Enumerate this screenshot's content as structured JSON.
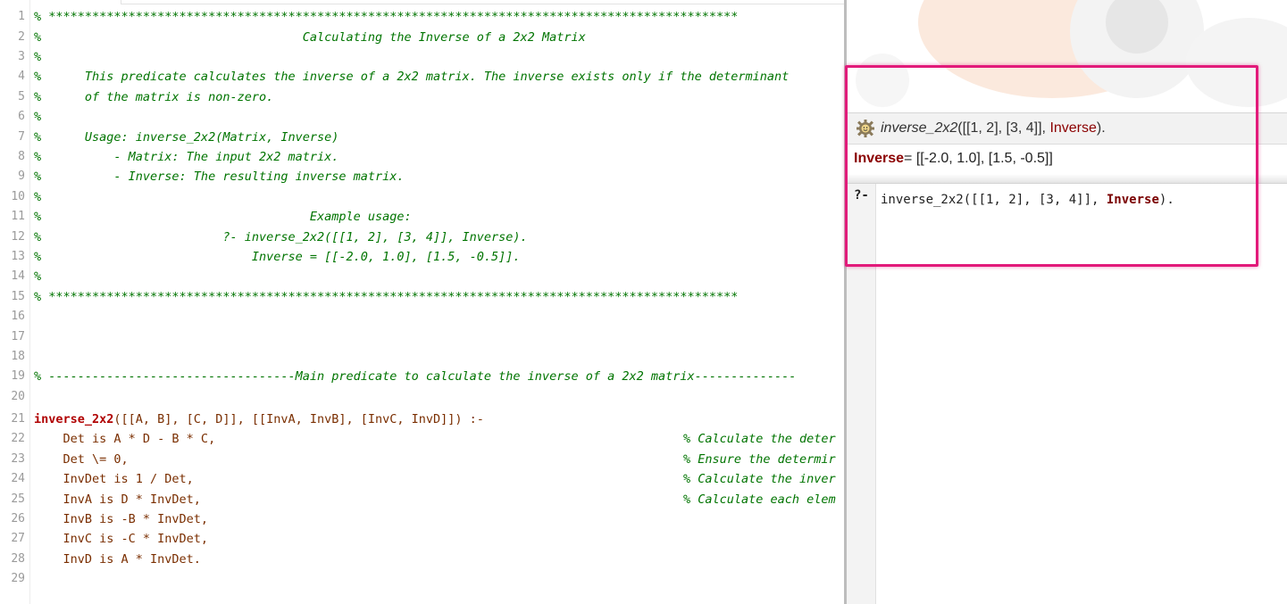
{
  "editor": {
    "lines": [
      {
        "n": "1",
        "text": "% ***********************************************************************************************"
      },
      {
        "n": "2",
        "text": "%                                    Calculating the Inverse of a 2x2 Matrix"
      },
      {
        "n": "3",
        "text": "%"
      },
      {
        "n": "4",
        "text": "%      This predicate calculates the inverse of a 2x2 matrix. The inverse exists only if the determinant"
      },
      {
        "n": "5",
        "text": "%      of the matrix is non-zero."
      },
      {
        "n": "6",
        "text": "%"
      },
      {
        "n": "7",
        "text": "%      Usage: inverse_2x2(Matrix, Inverse)"
      },
      {
        "n": "8",
        "text": "%          - Matrix: The input 2x2 matrix."
      },
      {
        "n": "9",
        "text": "%          - Inverse: The resulting inverse matrix."
      },
      {
        "n": "10",
        "text": "%"
      },
      {
        "n": "11",
        "text": "%                                     Example usage:"
      },
      {
        "n": "12",
        "text": "%                         ?- inverse_2x2([[1, 2], [3, 4]], Inverse)."
      },
      {
        "n": "13",
        "text": "%                             Inverse = [[-2.0, 1.0], [1.5, -0.5]]."
      },
      {
        "n": "14",
        "text": "%"
      },
      {
        "n": "15",
        "text": "% ***********************************************************************************************"
      },
      {
        "n": "16",
        "text": ""
      },
      {
        "n": "17",
        "text": ""
      },
      {
        "n": "18",
        "text": ""
      },
      {
        "n": "19",
        "text": "% ----------------------------------Main predicate to calculate the inverse of a 2x2 matrix--------------"
      },
      {
        "n": "20",
        "text": ""
      }
    ],
    "clause": {
      "n21": "21",
      "n22": "22",
      "n23": "23",
      "n24": "24",
      "n25": "25",
      "n26": "26",
      "n27": "27",
      "n28": "28",
      "n29": "29",
      "head_name": "inverse_2x2",
      "head_args": "([[A, B], [C, D]], [[InvA, InvB], [InvC, InvD]]) :-",
      "l22": "    Det is A * D - B * C,",
      "l23": "    Det \\= 0,",
      "l24": "    InvDet is 1 / Det,",
      "l25": "    InvA is D * InvDet,",
      "l26": "    InvB is -B * InvDet,",
      "l27": "    InvC is -C * InvDet,",
      "l28": "    InvD is A * InvDet.",
      "c22": "% Calculate the deter",
      "c23": "% Ensure the determir",
      "c24": "% Calculate the inver",
      "c25": "% Calculate each elem"
    }
  },
  "query": {
    "name": "inverse_2x2",
    "args_before": "([[1, 2], [3, 4]], ",
    "var": "Inverse",
    "end": ")."
  },
  "answer": {
    "var": "Inverse",
    "value": " = [[-2.0, 1.0], [1.5, -0.5]]"
  },
  "prompt": {
    "symbol": "?-",
    "input_before": "inverse_2x2([[1, 2], [3, 4]], ",
    "input_var": "Inverse",
    "input_end": ")."
  },
  "colors": {
    "highlight": "#e21a7a",
    "comment": "#007400",
    "functor": "#b00000",
    "keyword": "#0000cc"
  }
}
